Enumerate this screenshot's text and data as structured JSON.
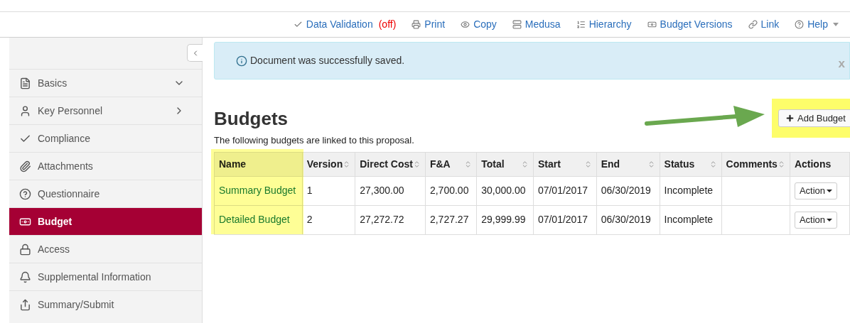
{
  "toolbar": [
    {
      "label": "Data Validation",
      "status": "(off)"
    },
    {
      "label": "Print"
    },
    {
      "label": "Copy"
    },
    {
      "label": "Medusa"
    },
    {
      "label": "Hierarchy"
    },
    {
      "label": "Budget Versions"
    },
    {
      "label": "Link"
    },
    {
      "label": "Help",
      "dropdown": true
    }
  ],
  "sidebar": {
    "items": [
      {
        "label": "Basics",
        "expanded": true,
        "selected": false
      },
      {
        "label": "Key Personnel",
        "expanded": false,
        "selected": false
      },
      {
        "label": "Compliance",
        "selected": false
      },
      {
        "label": "Attachments",
        "selected": false
      },
      {
        "label": "Questionnaire",
        "selected": false
      },
      {
        "label": "Budget",
        "selected": true
      },
      {
        "label": "Access",
        "selected": false
      },
      {
        "label": "Supplemental Information",
        "selected": false
      },
      {
        "label": "Summary/Submit",
        "selected": false
      }
    ]
  },
  "alert": {
    "message": "Document was successfully saved.",
    "close": "x"
  },
  "heading": "Budgets",
  "add_button": "Add Budget",
  "description": "The following budgets are linked to this proposal.",
  "table": {
    "columns": [
      {
        "label": "Name",
        "sortable": false
      },
      {
        "label": "Version",
        "sortable": true
      },
      {
        "label": "Direct Cost",
        "sortable": true
      },
      {
        "label": "F&A",
        "sortable": true
      },
      {
        "label": "Total",
        "sortable": true
      },
      {
        "label": "Start",
        "sortable": true
      },
      {
        "label": "End",
        "sortable": true
      },
      {
        "label": "Status",
        "sortable": true
      },
      {
        "label": "Comments",
        "sortable": true
      },
      {
        "label": "Actions",
        "sortable": false
      }
    ],
    "rows": [
      {
        "cells": [
          "Summary Budget",
          "1",
          "27,300.00",
          "2,700.00",
          "30,000.00",
          "07/01/2017",
          "06/30/2019",
          "Incomplete",
          ""
        ],
        "action": "Action"
      },
      {
        "cells": [
          "Detailed Budget",
          "2",
          "27,272.72",
          "2,727.27",
          "29,999.99",
          "07/01/2017",
          "06/30/2019",
          "Incomplete",
          ""
        ],
        "action": "Action"
      }
    ]
  }
}
